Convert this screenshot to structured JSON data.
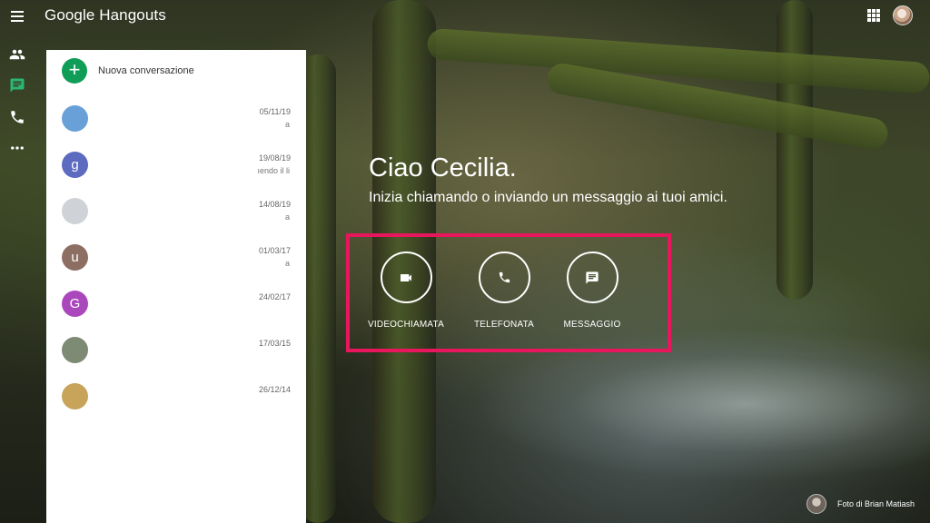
{
  "app": {
    "title": "Google Hangouts"
  },
  "header": {
    "apps_icon": "apps-grid-icon",
    "account_avatar": "account-avatar"
  },
  "rail": {
    "items": [
      {
        "icon": "contacts-icon"
      },
      {
        "icon": "chat-icon",
        "active": true
      },
      {
        "icon": "phone-icon"
      },
      {
        "icon": "more-icon"
      }
    ]
  },
  "sidebar": {
    "new_conversation": "Nuova conversazione",
    "conversations": [
      {
        "avatar": "",
        "date": "05/11/19",
        "snippet": "a",
        "color": "#6aa0d8"
      },
      {
        "avatar": "g",
        "date": "19/08/19",
        "snippet": "ıendo il li",
        "color": "#5c6bc0"
      },
      {
        "avatar": "",
        "date": "14/08/19",
        "snippet": "a",
        "color": "#cfd2d6"
      },
      {
        "avatar": "u",
        "date": "01/03/17",
        "snippet": "a",
        "color": "#8d6e63"
      },
      {
        "avatar": "G",
        "date": "24/02/17",
        "snippet": "",
        "color": "#ab47bc"
      },
      {
        "avatar": "",
        "date": "17/03/15",
        "snippet": "",
        "color": "#7d8a74"
      },
      {
        "avatar": "",
        "date": "26/12/14",
        "snippet": "",
        "color": "#c7a45a"
      }
    ]
  },
  "main": {
    "greeting": "Ciao Cecilia.",
    "subtitle": "Inizia chiamando o inviando un messaggio ai tuoi amici.",
    "actions": [
      {
        "label": "VIDEOCHIAMATA",
        "icon": "videocam-icon"
      },
      {
        "label": "TELEFONATA",
        "icon": "phone-icon"
      },
      {
        "label": "MESSAGGIO",
        "icon": "message-icon"
      }
    ],
    "highlight_color": "#e8165c"
  },
  "footer": {
    "photo_credit": "Foto di Brian Matiash"
  }
}
